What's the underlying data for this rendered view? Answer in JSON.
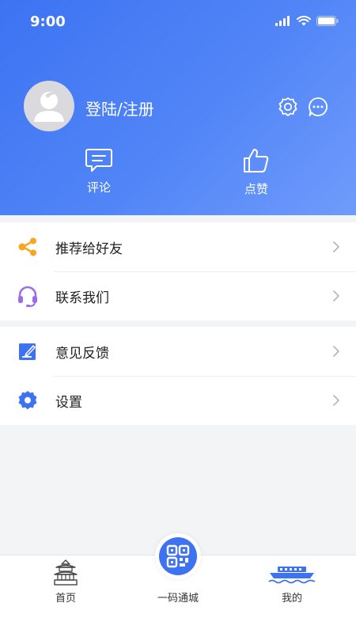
{
  "status_bar": {
    "time": "9:00"
  },
  "profile": {
    "login_text": "登陆/注册"
  },
  "quick_actions": [
    {
      "label": "评论",
      "icon": "comment-icon"
    },
    {
      "label": "点赞",
      "icon": "thumbs-up-icon"
    }
  ],
  "menu": {
    "group1": [
      {
        "label": "推荐给好友",
        "icon": "share-icon",
        "color": "#f5a623"
      },
      {
        "label": "联系我们",
        "icon": "headset-icon",
        "color": "#9b6cf0"
      }
    ],
    "group2": [
      {
        "label": "意见反馈",
        "icon": "feedback-edit-icon",
        "color": "#3d73f2"
      },
      {
        "label": "设置",
        "icon": "gear-icon",
        "color": "#3d73f2"
      }
    ]
  },
  "tabbar": [
    {
      "label": "首页",
      "icon": "pagoda-icon"
    },
    {
      "label": "一码通城",
      "icon": "qr-code-icon"
    },
    {
      "label": "我的",
      "icon": "boat-icon"
    }
  ],
  "colors": {
    "primary": "#3d73f2",
    "background": "#f3f4f6"
  }
}
